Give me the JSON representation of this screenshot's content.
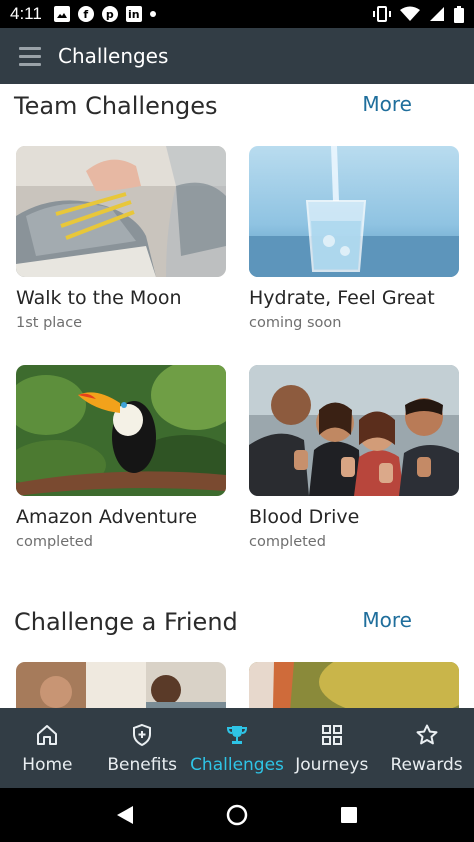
{
  "status_bar": {
    "time": "4:11"
  },
  "app_bar": {
    "title": "Challenges"
  },
  "team_section": {
    "title": "Team Challenges",
    "more_label": "More",
    "cards": [
      {
        "title": "Walk to the Moon",
        "status": "1st place"
      },
      {
        "title": "Hydrate, Feel Great",
        "status": "coming soon"
      },
      {
        "title": "Amazon Adventure",
        "status": "completed"
      },
      {
        "title": "Blood Drive",
        "status": "completed"
      }
    ]
  },
  "friend_section": {
    "title": "Challenge a Friend",
    "more_label": "More"
  },
  "bottom_nav": {
    "items": [
      {
        "label": "Home",
        "icon": "home-icon"
      },
      {
        "label": "Benefits",
        "icon": "shield-plus-icon"
      },
      {
        "label": "Challenges",
        "icon": "trophy-icon",
        "active": true
      },
      {
        "label": "Journeys",
        "icon": "grid-icon"
      },
      {
        "label": "Rewards",
        "icon": "star-icon"
      }
    ]
  },
  "colors": {
    "app_bar": "#323d45",
    "accent": "#2ec4e6",
    "link": "#1f6e9c"
  }
}
